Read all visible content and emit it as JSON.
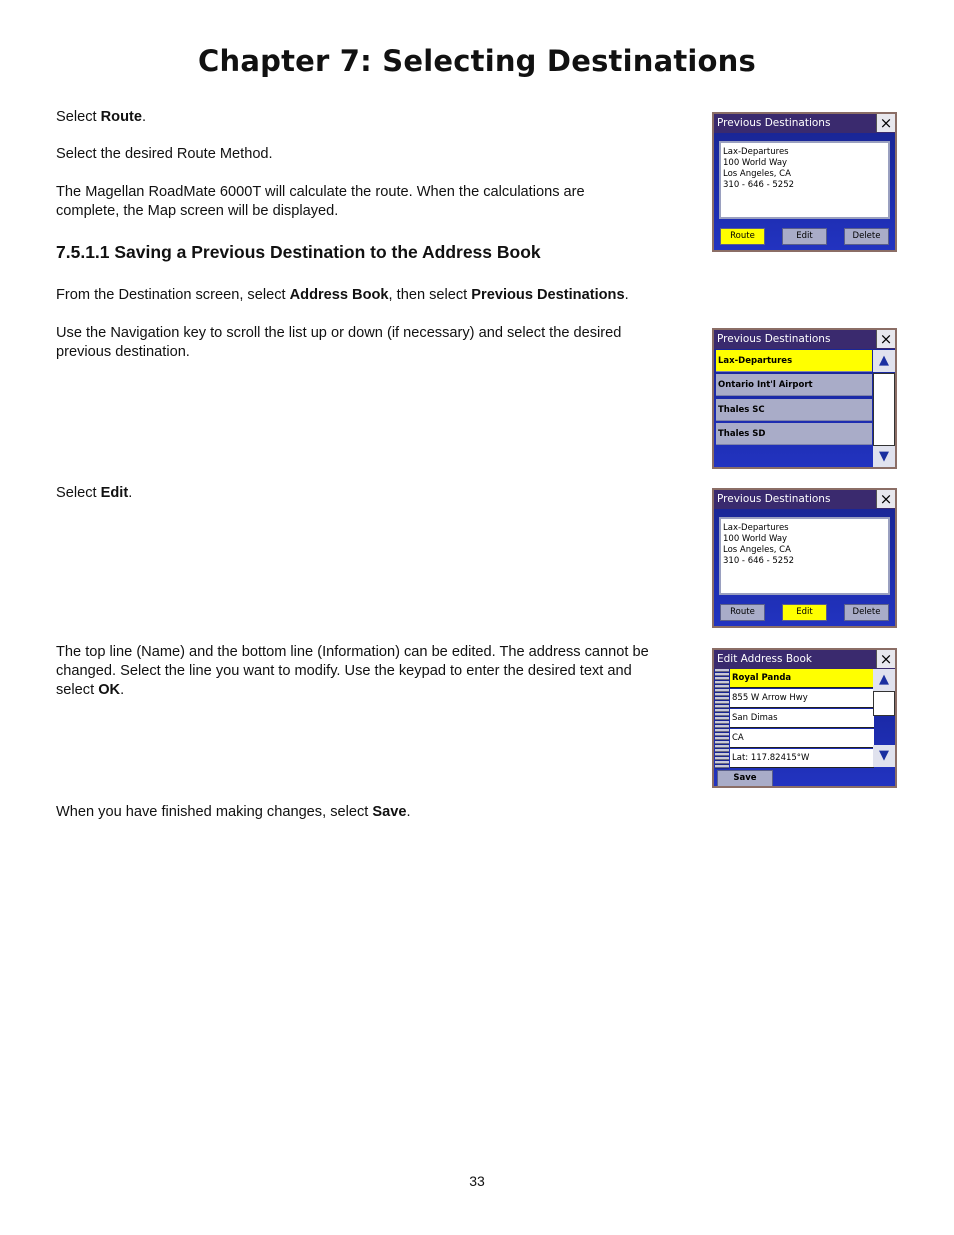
{
  "page": {
    "chapter_title": "Chapter 7: Selecting Destinations",
    "page_number": "33"
  },
  "content": {
    "p1": {
      "pre": "Select ",
      "bold": "Route",
      "post": "."
    },
    "p2": "Select the desired Route Method.",
    "p3": "The Magellan RoadMate 6000T will calculate the route. When the calculations are complete, the Map screen will be displayed.",
    "section_heading": "7.5.1.1 Saving a Previous Destination to the Address Book",
    "p4": {
      "pre": "From the Destination screen, select ",
      "bold1": "Address Book",
      "mid": ", then select ",
      "bold2": "Previous Destinations",
      "post": "."
    },
    "p5": "Use the Navigation key to scroll the list up or down (if necessary) and select the desired previous destination.",
    "p6": {
      "pre": "Select ",
      "bold": "Edit",
      "post": "."
    },
    "p7": {
      "pre": "The top line (Name) and the bottom line (Information) can be edited. The address cannot be changed. Select the line you want to modify. Use the keypad to enter the desired text and select ",
      "bold": "OK",
      "post": "."
    },
    "p8": {
      "pre": "When you have finished making changes, select ",
      "bold": "Save",
      "post": "."
    }
  },
  "screens": {
    "details_route": {
      "title": "Previous Destinations",
      "close_icon": "×",
      "lines": [
        "Lax-Departures",
        "100 World Way",
        "Los Angeles, CA",
        "310 - 646 - 5252"
      ],
      "buttons": [
        "Route",
        "Edit",
        "Delete"
      ],
      "selected": "Route"
    },
    "list": {
      "title": "Previous Destinations",
      "close_icon": "×",
      "items": [
        "Lax-Departures",
        "Ontario Int'l Airport",
        "Thales SC",
        "Thales SD"
      ],
      "selected": "Lax-Departures",
      "up_icon": "▲",
      "down_icon": "▼"
    },
    "details_edit": {
      "title": "Previous Destinations",
      "close_icon": "×",
      "lines": [
        "Lax-Departures",
        "100 World Way",
        "Los Angeles, CA",
        "310 - 646 - 5252"
      ],
      "buttons": [
        "Route",
        "Edit",
        "Delete"
      ],
      "selected": "Edit"
    },
    "edit_address_book": {
      "title": "Edit Address Book",
      "close_icon": "×",
      "rows": [
        "Royal Panda",
        "855 W Arrow Hwy",
        "San Dimas",
        "CA",
        "Lat:  117.82415°W"
      ],
      "selected": "Royal Panda",
      "save_label": "Save",
      "up_icon": "▲",
      "down_icon": "▼"
    }
  },
  "colors": {
    "selected_yellow": "#ffff00",
    "screen_blue": "#1b2aa8",
    "titlebar_purple": "#3a2a6e",
    "button_gray": "#a9acc8"
  }
}
